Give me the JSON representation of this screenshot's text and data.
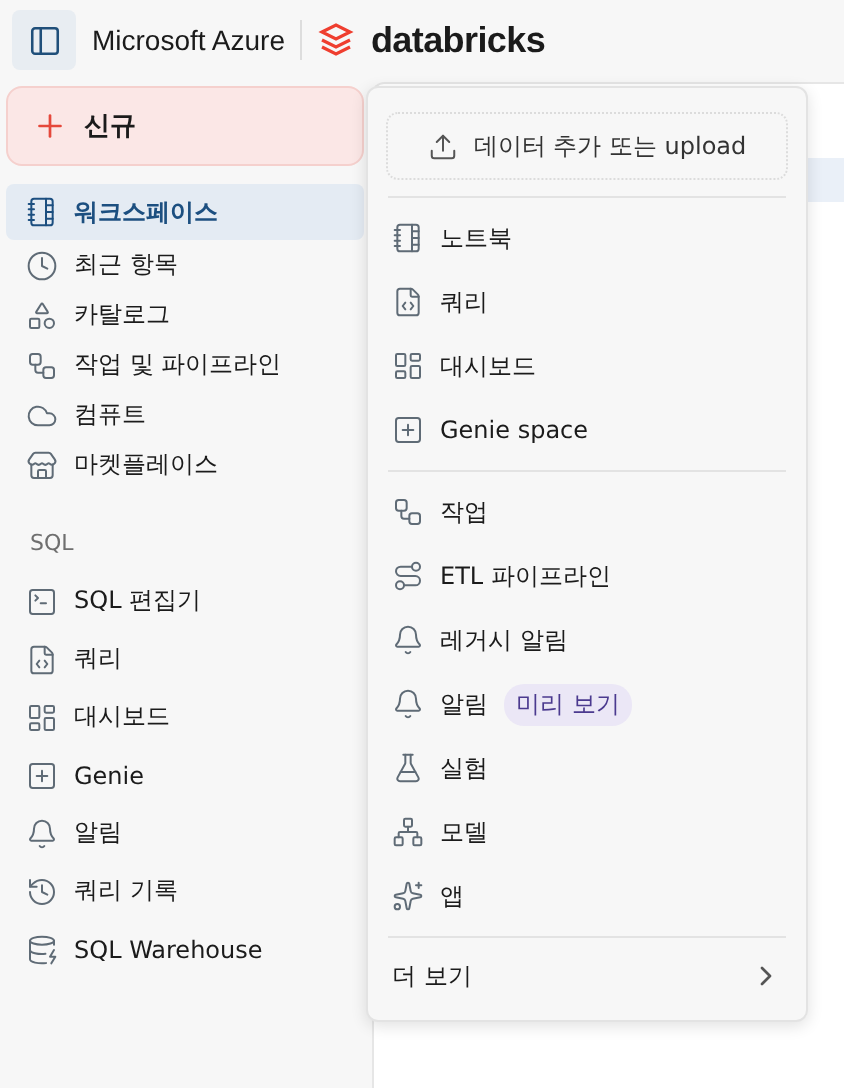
{
  "header": {
    "brand": "Microsoft Azure",
    "product": "databricks"
  },
  "sidebar": {
    "new_button": "신규",
    "items": [
      {
        "label": "워크스페이스",
        "selected": true
      },
      {
        "label": "최근 항목",
        "selected": false
      },
      {
        "label": "카탈로그",
        "selected": false
      },
      {
        "label": "작업 및 파이프라인",
        "selected": false
      },
      {
        "label": "컴퓨트",
        "selected": false
      },
      {
        "label": "마켓플레이스",
        "selected": false
      }
    ],
    "section_label": "SQL",
    "sql_items": [
      {
        "label": "SQL 편집기",
        "selected": false
      },
      {
        "label": "쿼리",
        "selected": false
      },
      {
        "label": "대시보드",
        "selected": false
      },
      {
        "label": "Genie",
        "selected": false
      },
      {
        "label": "알림",
        "selected": false
      },
      {
        "label": "쿼리 기록",
        "selected": false
      },
      {
        "label": "SQL Warehouse",
        "selected": false
      }
    ]
  },
  "menu": {
    "upload_button": "데이터 추가 또는 upload",
    "groups": [
      [
        {
          "label": "노트북"
        },
        {
          "label": "쿼리"
        },
        {
          "label": "대시보드"
        },
        {
          "label": "Genie space"
        }
      ],
      [
        {
          "label": "작업"
        },
        {
          "label": "ETL 파이프라인"
        },
        {
          "label": "레거시 알림"
        },
        {
          "label": "알림",
          "badge": "미리 보기"
        },
        {
          "label": "실험"
        },
        {
          "label": "모델"
        },
        {
          "label": "앱"
        }
      ]
    ],
    "more": "더 보기"
  }
}
